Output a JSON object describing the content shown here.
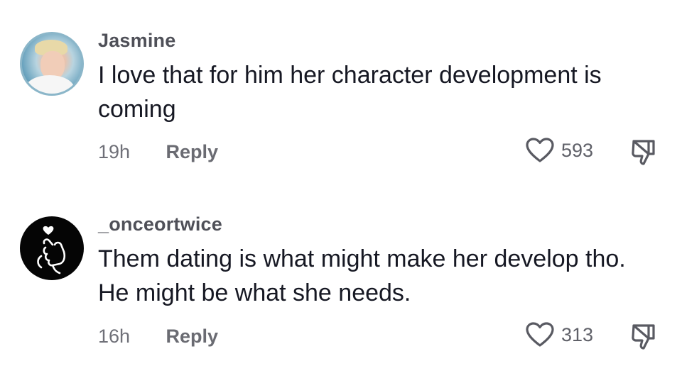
{
  "comments": [
    {
      "username": "Jasmine",
      "text": "I love that for him her character development is coming",
      "time": "19h",
      "reply_label": "Reply",
      "likes": "593",
      "avatar": "photo-avatar"
    },
    {
      "username": "_onceortwice",
      "text": "Them dating is what might make her develop tho. He might be what she needs.",
      "time": "16h",
      "reply_label": "Reply",
      "likes": "313",
      "avatar": "finger-heart-hand-icon"
    }
  ],
  "colors": {
    "username": "#4f5058",
    "text": "#161823",
    "meta": "#6f7078",
    "background": "#ffffff"
  }
}
